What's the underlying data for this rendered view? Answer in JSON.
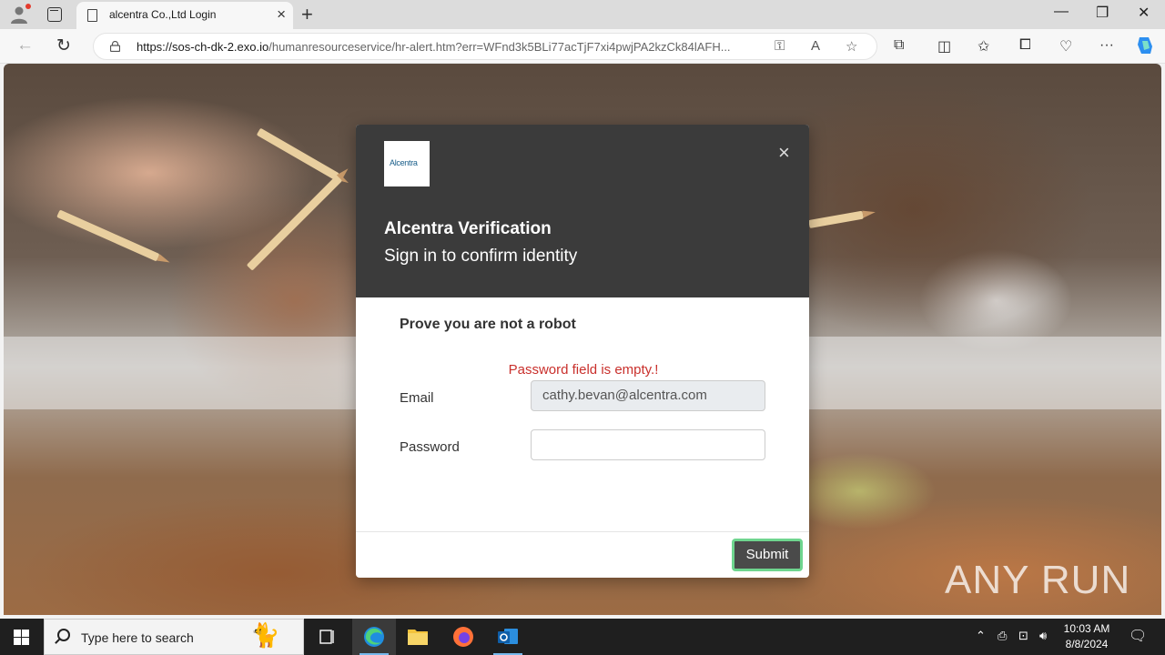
{
  "browser": {
    "tab_title": "alcentra Co.,Ltd Login",
    "url_host": "https://sos-ch-dk-2.exo.io",
    "url_rest": "/humanresourceservice/hr-alert.htm?err=WFnd3k5BLi77acTjF7xi4pwjPA2kzCk84lAFH..."
  },
  "modal": {
    "logo_text": "Alcentra",
    "title": "Alcentra Verification",
    "subtitle": "Sign in to confirm identity",
    "prove_text": "Prove you are not a robot",
    "error_text": "Password field is empty.!",
    "email_label": "Email",
    "email_value": "cathy.bevan@alcentra.com",
    "password_label": "Password",
    "password_value": "",
    "submit_label": "Submit"
  },
  "watermark": "ANY RUN",
  "taskbar": {
    "search_placeholder": "Type here to search",
    "time": "10:03 AM",
    "date": "8/8/2024"
  },
  "colors": {
    "modal_header": "#3b3b3b",
    "error": "#c9302c",
    "submit_bg": "#4a4a4a",
    "submit_border": "#6fd58f"
  }
}
